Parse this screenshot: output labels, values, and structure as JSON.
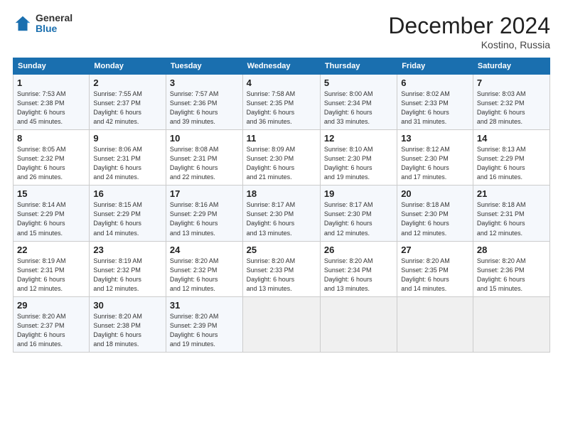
{
  "logo": {
    "general": "General",
    "blue": "Blue"
  },
  "title": "December 2024",
  "location": "Kostino, Russia",
  "days_header": [
    "Sunday",
    "Monday",
    "Tuesday",
    "Wednesday",
    "Thursday",
    "Friday",
    "Saturday"
  ],
  "weeks": [
    [
      {
        "day": "1",
        "info": "Sunrise: 7:53 AM\nSunset: 2:38 PM\nDaylight: 6 hours\nand 45 minutes."
      },
      {
        "day": "2",
        "info": "Sunrise: 7:55 AM\nSunset: 2:37 PM\nDaylight: 6 hours\nand 42 minutes."
      },
      {
        "day": "3",
        "info": "Sunrise: 7:57 AM\nSunset: 2:36 PM\nDaylight: 6 hours\nand 39 minutes."
      },
      {
        "day": "4",
        "info": "Sunrise: 7:58 AM\nSunset: 2:35 PM\nDaylight: 6 hours\nand 36 minutes."
      },
      {
        "day": "5",
        "info": "Sunrise: 8:00 AM\nSunset: 2:34 PM\nDaylight: 6 hours\nand 33 minutes."
      },
      {
        "day": "6",
        "info": "Sunrise: 8:02 AM\nSunset: 2:33 PM\nDaylight: 6 hours\nand 31 minutes."
      },
      {
        "day": "7",
        "info": "Sunrise: 8:03 AM\nSunset: 2:32 PM\nDaylight: 6 hours\nand 28 minutes."
      }
    ],
    [
      {
        "day": "8",
        "info": "Sunrise: 8:05 AM\nSunset: 2:32 PM\nDaylight: 6 hours\nand 26 minutes."
      },
      {
        "day": "9",
        "info": "Sunrise: 8:06 AM\nSunset: 2:31 PM\nDaylight: 6 hours\nand 24 minutes."
      },
      {
        "day": "10",
        "info": "Sunrise: 8:08 AM\nSunset: 2:31 PM\nDaylight: 6 hours\nand 22 minutes."
      },
      {
        "day": "11",
        "info": "Sunrise: 8:09 AM\nSunset: 2:30 PM\nDaylight: 6 hours\nand 21 minutes."
      },
      {
        "day": "12",
        "info": "Sunrise: 8:10 AM\nSunset: 2:30 PM\nDaylight: 6 hours\nand 19 minutes."
      },
      {
        "day": "13",
        "info": "Sunrise: 8:12 AM\nSunset: 2:30 PM\nDaylight: 6 hours\nand 17 minutes."
      },
      {
        "day": "14",
        "info": "Sunrise: 8:13 AM\nSunset: 2:29 PM\nDaylight: 6 hours\nand 16 minutes."
      }
    ],
    [
      {
        "day": "15",
        "info": "Sunrise: 8:14 AM\nSunset: 2:29 PM\nDaylight: 6 hours\nand 15 minutes."
      },
      {
        "day": "16",
        "info": "Sunrise: 8:15 AM\nSunset: 2:29 PM\nDaylight: 6 hours\nand 14 minutes."
      },
      {
        "day": "17",
        "info": "Sunrise: 8:16 AM\nSunset: 2:29 PM\nDaylight: 6 hours\nand 13 minutes."
      },
      {
        "day": "18",
        "info": "Sunrise: 8:17 AM\nSunset: 2:30 PM\nDaylight: 6 hours\nand 13 minutes."
      },
      {
        "day": "19",
        "info": "Sunrise: 8:17 AM\nSunset: 2:30 PM\nDaylight: 6 hours\nand 12 minutes."
      },
      {
        "day": "20",
        "info": "Sunrise: 8:18 AM\nSunset: 2:30 PM\nDaylight: 6 hours\nand 12 minutes."
      },
      {
        "day": "21",
        "info": "Sunrise: 8:18 AM\nSunset: 2:31 PM\nDaylight: 6 hours\nand 12 minutes."
      }
    ],
    [
      {
        "day": "22",
        "info": "Sunrise: 8:19 AM\nSunset: 2:31 PM\nDaylight: 6 hours\nand 12 minutes."
      },
      {
        "day": "23",
        "info": "Sunrise: 8:19 AM\nSunset: 2:32 PM\nDaylight: 6 hours\nand 12 minutes."
      },
      {
        "day": "24",
        "info": "Sunrise: 8:20 AM\nSunset: 2:32 PM\nDaylight: 6 hours\nand 12 minutes."
      },
      {
        "day": "25",
        "info": "Sunrise: 8:20 AM\nSunset: 2:33 PM\nDaylight: 6 hours\nand 13 minutes."
      },
      {
        "day": "26",
        "info": "Sunrise: 8:20 AM\nSunset: 2:34 PM\nDaylight: 6 hours\nand 13 minutes."
      },
      {
        "day": "27",
        "info": "Sunrise: 8:20 AM\nSunset: 2:35 PM\nDaylight: 6 hours\nand 14 minutes."
      },
      {
        "day": "28",
        "info": "Sunrise: 8:20 AM\nSunset: 2:36 PM\nDaylight: 6 hours\nand 15 minutes."
      }
    ],
    [
      {
        "day": "29",
        "info": "Sunrise: 8:20 AM\nSunset: 2:37 PM\nDaylight: 6 hours\nand 16 minutes."
      },
      {
        "day": "30",
        "info": "Sunrise: 8:20 AM\nSunset: 2:38 PM\nDaylight: 6 hours\nand 18 minutes."
      },
      {
        "day": "31",
        "info": "Sunrise: 8:20 AM\nSunset: 2:39 PM\nDaylight: 6 hours\nand 19 minutes."
      },
      {
        "day": "",
        "info": ""
      },
      {
        "day": "",
        "info": ""
      },
      {
        "day": "",
        "info": ""
      },
      {
        "day": "",
        "info": ""
      }
    ]
  ]
}
